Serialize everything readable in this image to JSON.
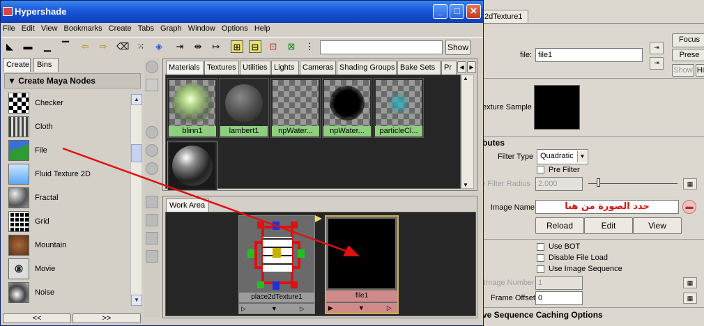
{
  "hypershade": {
    "title": "Hypershade",
    "menu": [
      "File",
      "Edit",
      "View",
      "Bookmarks",
      "Create",
      "Tabs",
      "Graph",
      "Window",
      "Options",
      "Help"
    ],
    "show_button": "Show",
    "search_value": "",
    "left_tabs": [
      "Create",
      "Bins"
    ],
    "create_header": "Create Maya Nodes",
    "nodes": [
      "Checker",
      "Cloth",
      "File",
      "Fluid Texture 2D",
      "Fractal",
      "Grid",
      "Mountain",
      "Movie",
      "Noise"
    ],
    "hscroll": [
      "<<",
      ">>"
    ],
    "material_tabs": [
      "Materials",
      "Textures",
      "Utilities",
      "Lights",
      "Cameras",
      "Shading Groups",
      "Bake Sets",
      "Pr"
    ],
    "swatches": [
      "blinn1",
      "lambert1",
      "npWater...",
      "npWater...",
      "particleCl..."
    ],
    "work_tab": "Work Area",
    "work_nodes": [
      "place2dTexture1",
      "file1"
    ]
  },
  "attr_editor": {
    "tab": "2dTexture1",
    "buttons": [
      "Focus",
      "Prese",
      "Show",
      "Hid"
    ],
    "file_label": "file:",
    "file_value": "file1",
    "sample_label": "exture Sample",
    "section_attrs": "butes",
    "filter_type_label": "Filter Type",
    "filter_type_value": "Quadratic",
    "pre_filter": "Pre Filter",
    "pre_filter_radius_label": "e Filter Radius",
    "pre_filter_radius_value": "2.000",
    "image_name_label": "Image Name",
    "image_name_value": "حدد الصورة من هنا",
    "reload": "Reload",
    "edit": "Edit",
    "view": "View",
    "use_bot": "Use BOT",
    "disable_file_load": "Disable File Load",
    "use_image_sequence": "Use Image Sequence",
    "image_number_label": "Image Number",
    "image_number_value": "1",
    "frame_offset_label": "Frame Offset",
    "frame_offset_value": "0",
    "section_caching": "ve Sequence Caching Options"
  },
  "colors": {
    "swatch_label": "#8ece7e",
    "file_node_label": "#d08a8a",
    "arrow": "#e01010",
    "annotation": "#e01010"
  }
}
